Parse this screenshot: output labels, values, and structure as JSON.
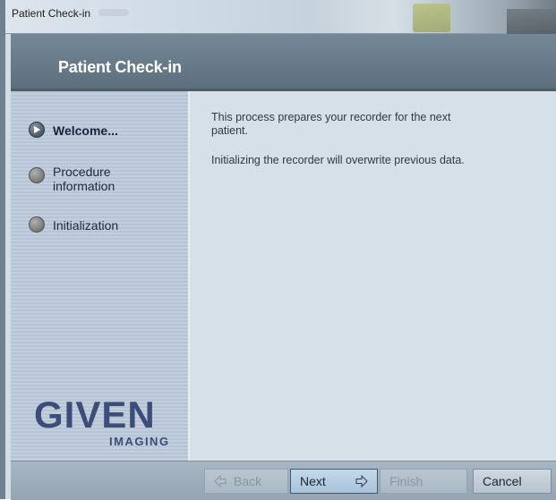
{
  "window": {
    "title": "Patient Check-in"
  },
  "header": {
    "title": "Patient Check-in"
  },
  "steps": [
    {
      "label": "Welcome...",
      "active": true
    },
    {
      "label_line1": "Procedure",
      "label_line2": "information",
      "active": false
    },
    {
      "label": "Initialization",
      "active": false
    }
  ],
  "logo": {
    "word": "GIVEN",
    "sub": "IMAGING"
  },
  "content": {
    "line1": "This process prepares your recorder for the next patient.",
    "line2": "Initializing the recorder will overwrite previous data."
  },
  "buttons": {
    "back": "Back",
    "next": "Next",
    "finish": "Finish",
    "cancel": "Cancel"
  },
  "icons": {
    "step_active": "play-arrow-icon",
    "back": "arrow-left-icon",
    "next": "arrow-right-icon"
  },
  "colors": {
    "header_bg": "#667988",
    "sidebar_bg": "#bdc9d9",
    "content_bg": "#d5e0e8",
    "logo": "#3d4d7a"
  }
}
